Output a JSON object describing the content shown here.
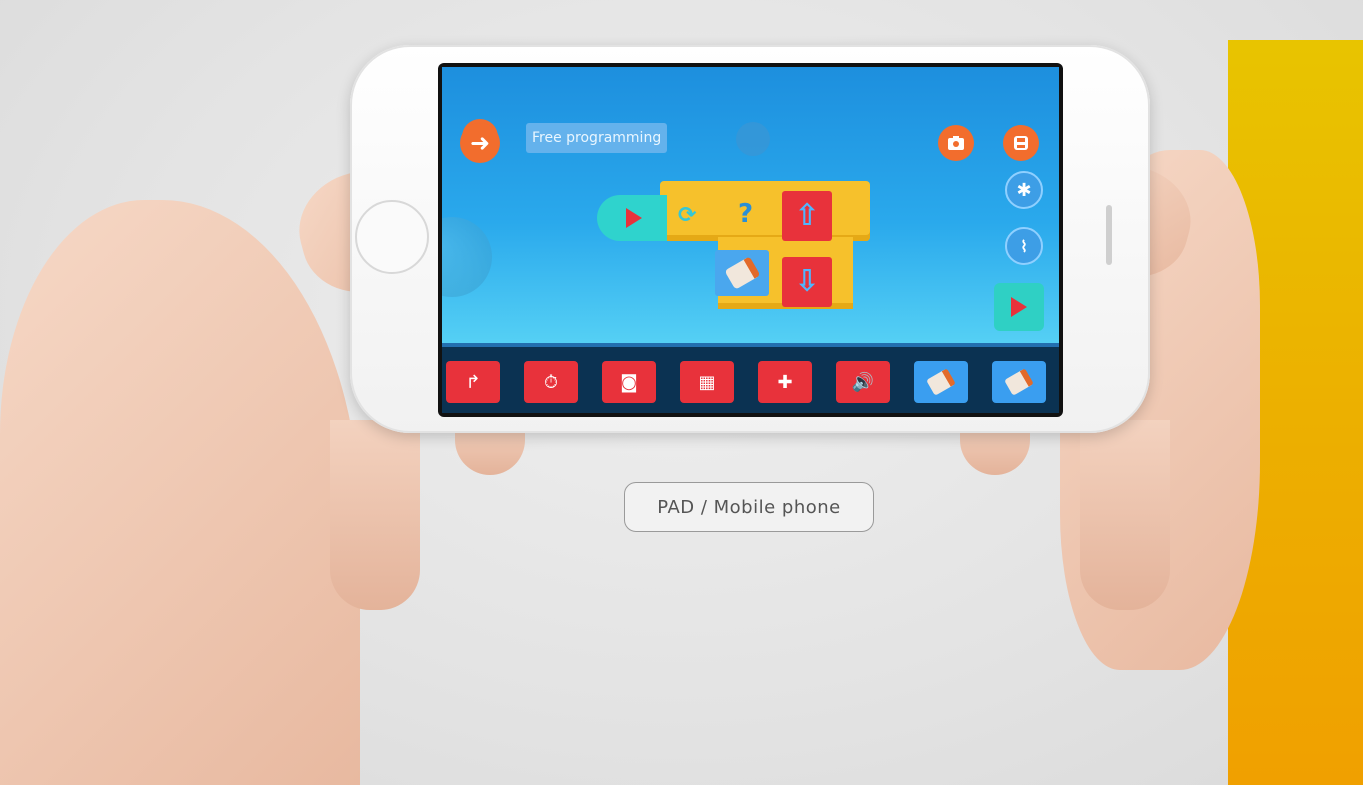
{
  "app": {
    "title": "Free programming"
  },
  "top_right_buttons": [
    {
      "icon": "camera-icon"
    },
    {
      "icon": "save-icon"
    },
    {
      "icon": "bluetooth-icon"
    },
    {
      "icon": "broom-clear-icon"
    }
  ],
  "run_button": {
    "icon": "play-icon"
  },
  "program_blocks": [
    {
      "type": "start",
      "icon": "play-icon"
    },
    {
      "type": "loop",
      "icon": "repeat-icon"
    },
    {
      "type": "condition",
      "label": "?"
    },
    {
      "type": "move-forward",
      "icon": "arrow-up-icon",
      "label": "⇧"
    },
    {
      "type": "move-backward",
      "icon": "arrow-down-icon",
      "label": "⇩"
    },
    {
      "type": "sensor",
      "icon": "sensor-icon"
    }
  ],
  "palette": [
    {
      "icon": "turn-icon",
      "label": "↱",
      "color": "#e8323b"
    },
    {
      "icon": "car-timer-icon",
      "label": "⏱",
      "color": "#e8323b"
    },
    {
      "icon": "car-sensor-icon",
      "label": "◙",
      "color": "#e8323b"
    },
    {
      "icon": "display-icon",
      "label": "▦",
      "color": "#e8323b"
    },
    {
      "icon": "light-icon",
      "label": "✚",
      "color": "#e8323b"
    },
    {
      "icon": "speaker-icon",
      "label": "🔊",
      "color": "#e8323b"
    },
    {
      "icon": "sensor-a-icon",
      "label": "",
      "color": "#3a9ef0"
    },
    {
      "icon": "sensor-b-icon",
      "label": "",
      "color": "#3a9ef0"
    }
  ],
  "caption": "PAD / Mobile phone",
  "colors": {
    "accent_orange": "#f26d2d",
    "block_red": "#e8323b",
    "block_yellow": "#f6c12c",
    "block_teal": "#2fd3cd",
    "sky_blue": "#2aa9ec"
  }
}
